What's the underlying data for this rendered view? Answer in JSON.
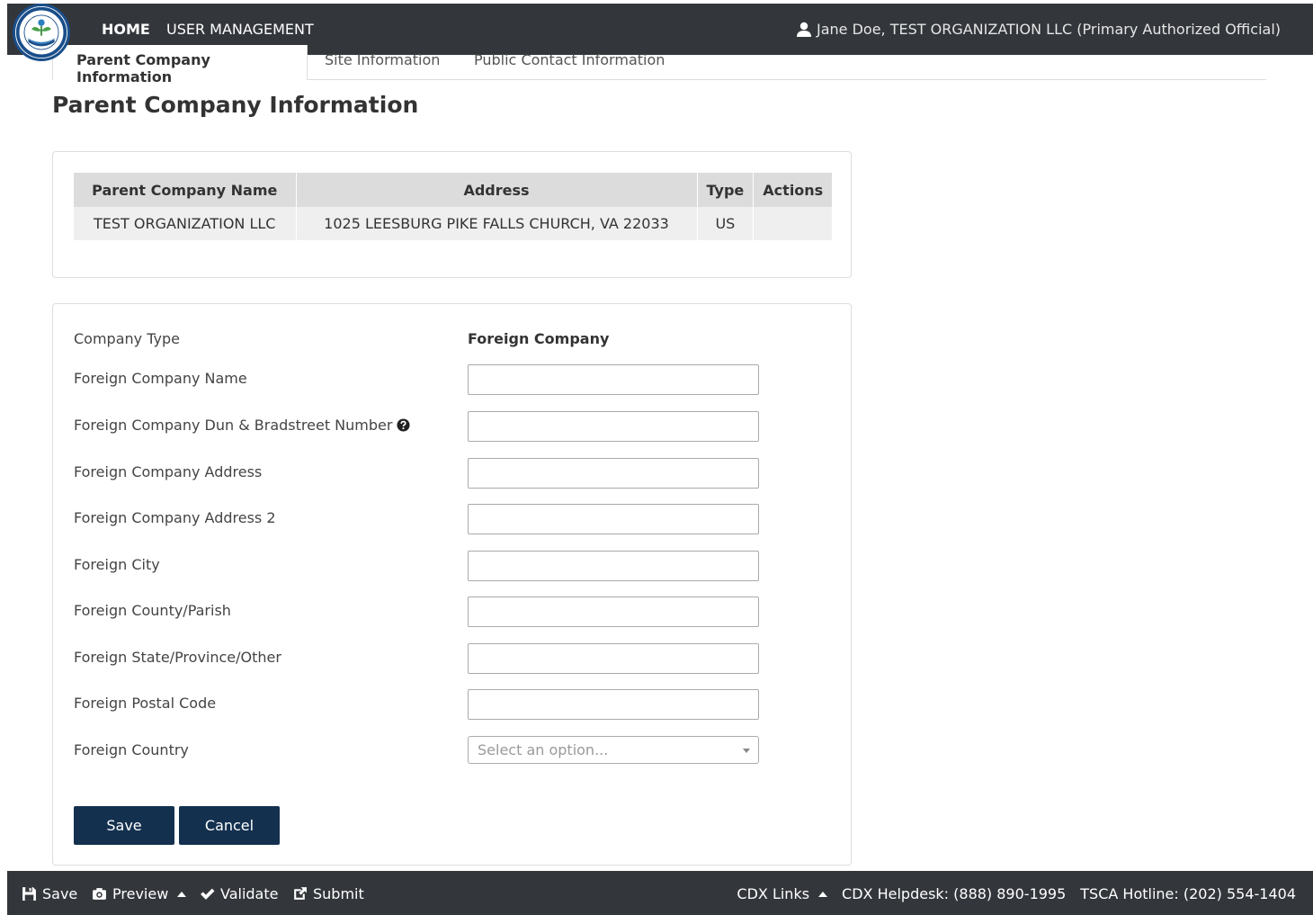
{
  "header": {
    "nav": {
      "home": "HOME",
      "user_management": "USER MANAGEMENT"
    },
    "user": "Jane Doe, TEST ORGANIZATION LLC (Primary Authorized Official)"
  },
  "tabs": [
    {
      "label": "Parent Company Information",
      "active": true
    },
    {
      "label": "Site Information",
      "active": false
    },
    {
      "label": "Public Contact Information",
      "active": false
    }
  ],
  "page_title": "Parent Company Information",
  "parent_table": {
    "headers": [
      "Parent Company Name",
      "Address",
      "Type",
      "Actions"
    ],
    "rows": [
      [
        "TEST ORGANIZATION LLC",
        "1025 LEESBURG PIKE FALLS CHURCH, VA 22033",
        "US",
        ""
      ]
    ]
  },
  "form": {
    "company_type_label": "Company Type",
    "company_type_value": "Foreign Company",
    "fields": [
      {
        "label": "Foreign Company Name",
        "value": ""
      },
      {
        "label": "Foreign Company Dun & Bradstreet Number",
        "value": ""
      },
      {
        "label": "Foreign Company Address",
        "value": ""
      },
      {
        "label": "Foreign Company Address 2",
        "value": ""
      },
      {
        "label": "Foreign City",
        "value": ""
      },
      {
        "label": "Foreign County/Parish",
        "value": ""
      },
      {
        "label": "Foreign State/Province/Other",
        "value": ""
      },
      {
        "label": "Foreign Postal Code",
        "value": ""
      }
    ],
    "country_label": "Foreign Country",
    "country_placeholder": "Select an option...",
    "save_label": "Save",
    "cancel_label": "Cancel"
  },
  "footer": {
    "save": "Save",
    "preview": "Preview",
    "validate": "Validate",
    "submit": "Submit",
    "cdx_links": "CDX Links",
    "helpdesk": "CDX Helpdesk: (888) 890-1995",
    "hotline": "TSCA Hotline: (202) 554-1404"
  },
  "colors": {
    "header_bg": "#33363b",
    "button_bg": "#14304f",
    "table_header_bg": "#dcdcdc",
    "table_row_bg": "#efefef"
  }
}
